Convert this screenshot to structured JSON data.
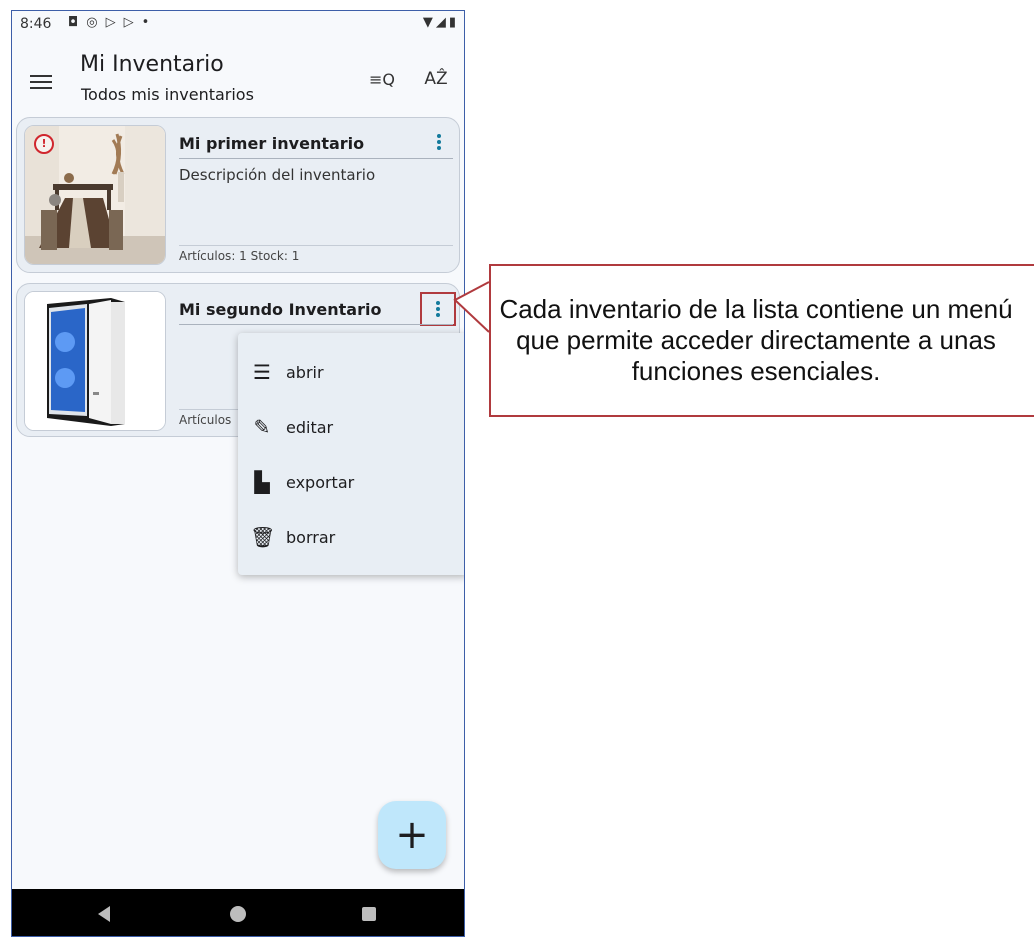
{
  "status_bar": {
    "time": "8:46",
    "icons": [
      "notification-icon",
      "cast-icon",
      "play-icon",
      "play-icon",
      "dot-icon"
    ],
    "right_icons": [
      "wifi-icon",
      "signal-icon",
      "battery-icon"
    ]
  },
  "toolbar": {
    "title": "Mi Inventario",
    "subtitle": "Todos mis inventarios",
    "search_filter_icon": "≡Q",
    "sort_icon": "AẐ"
  },
  "inventories": [
    {
      "title": "Mi primer inventario",
      "description": "Descripción del inventario",
      "footer": "Artículos: 1   Stock: 1",
      "warning": "!"
    },
    {
      "title": "Mi segundo Inventario",
      "description": "",
      "footer": "Artículos"
    }
  ],
  "item_menu": {
    "items": [
      {
        "icon": "list-icon",
        "glyph": "☰",
        "label": "abrir"
      },
      {
        "icon": "pencil-icon",
        "glyph": "✎",
        "label": "editar"
      },
      {
        "icon": "export-file-icon",
        "glyph": "▙",
        "label": "exportar"
      },
      {
        "icon": "trash-icon",
        "glyph": "🗑",
        "label": "borrar"
      }
    ]
  },
  "fab": {
    "label": "+"
  },
  "callout": {
    "text": "Cada inventario de la lista contiene un menú que permite acceder directamente a unas funciones esenciales."
  },
  "colors": {
    "accent": "#137a9c",
    "card_bg": "#e9eef4",
    "fab_bg": "#bfe7fb",
    "callout_border": "#b03a3e",
    "warning": "#d0262d"
  }
}
